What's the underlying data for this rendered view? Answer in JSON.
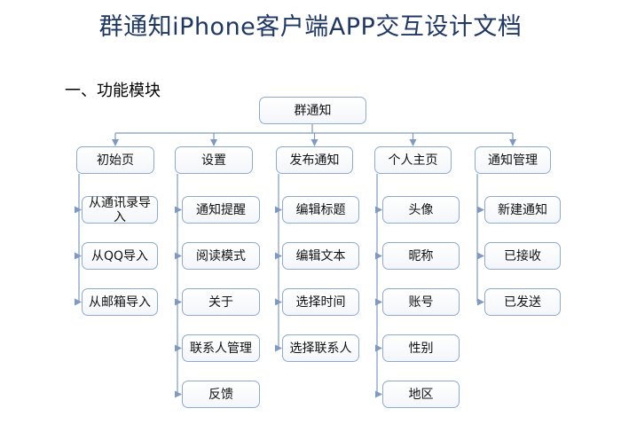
{
  "title": "群通知iPhone客户端APP交互设计文档",
  "section_heading": "一、功能模块",
  "root": "群通知",
  "modules": [
    {
      "name": "初始页",
      "children": [
        "从通讯录导入",
        "从QQ导入",
        "从邮箱导入"
      ]
    },
    {
      "name": "设置",
      "children": [
        "通知提醒",
        "阅读模式",
        "关于",
        "联系人管理",
        "反馈"
      ]
    },
    {
      "name": "发布通知",
      "children": [
        "编辑标题",
        "编辑文本",
        "选择时间",
        "选择联系人"
      ]
    },
    {
      "name": "个人主页",
      "children": [
        "头像",
        "昵称",
        "账号",
        "性别",
        "地区"
      ]
    },
    {
      "name": "通知管理",
      "children": [
        "新建通知",
        "已接收",
        "已发送"
      ]
    }
  ],
  "colors": {
    "title": "#1f3864",
    "node_border": "#8eaad0",
    "connector": "#7f99c2"
  }
}
